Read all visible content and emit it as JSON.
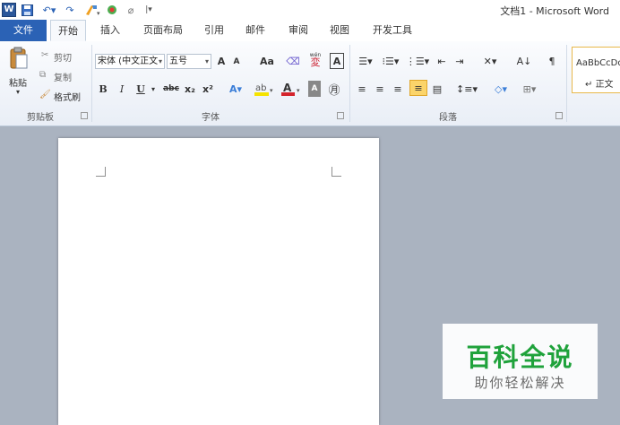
{
  "title": "文档1 - Microsoft Word",
  "quick_access": {
    "logo": "W",
    "save": "save-icon",
    "undo": "undo-icon",
    "redo": "redo-icon",
    "format_painter": "paint-icon",
    "misc": "color-icon",
    "customize": "customize-icon"
  },
  "tabs": [
    "文件",
    "开始",
    "插入",
    "页面布局",
    "引用",
    "邮件",
    "审阅",
    "视图",
    "开发工具"
  ],
  "clipboard": {
    "paste": "粘贴",
    "cut": "剪切",
    "copy": "复制",
    "format_painter": "格式刷",
    "group": "剪贴板"
  },
  "font": {
    "name": "宋体 (中文正文",
    "size": "五号",
    "grow": "A",
    "shrink": "A",
    "case": "Aa",
    "bold": "B",
    "italic": "I",
    "underline": "U",
    "strike": "abc",
    "subscript": "x₂",
    "superscript": "x²",
    "group": "字体",
    "phonetic": "wén",
    "border_char": "A"
  },
  "paragraph": {
    "group": "段落"
  },
  "styles": {
    "sample": "AaBbCcDd",
    "name": "正文"
  },
  "watermark": {
    "main": "百科全说",
    "sub": "助你轻松解决"
  },
  "colors": {
    "accent": "#2b62b5",
    "watermark_green": "#1fa23b",
    "highlight_yellow": "#f5e300",
    "font_red": "#d4242c"
  }
}
